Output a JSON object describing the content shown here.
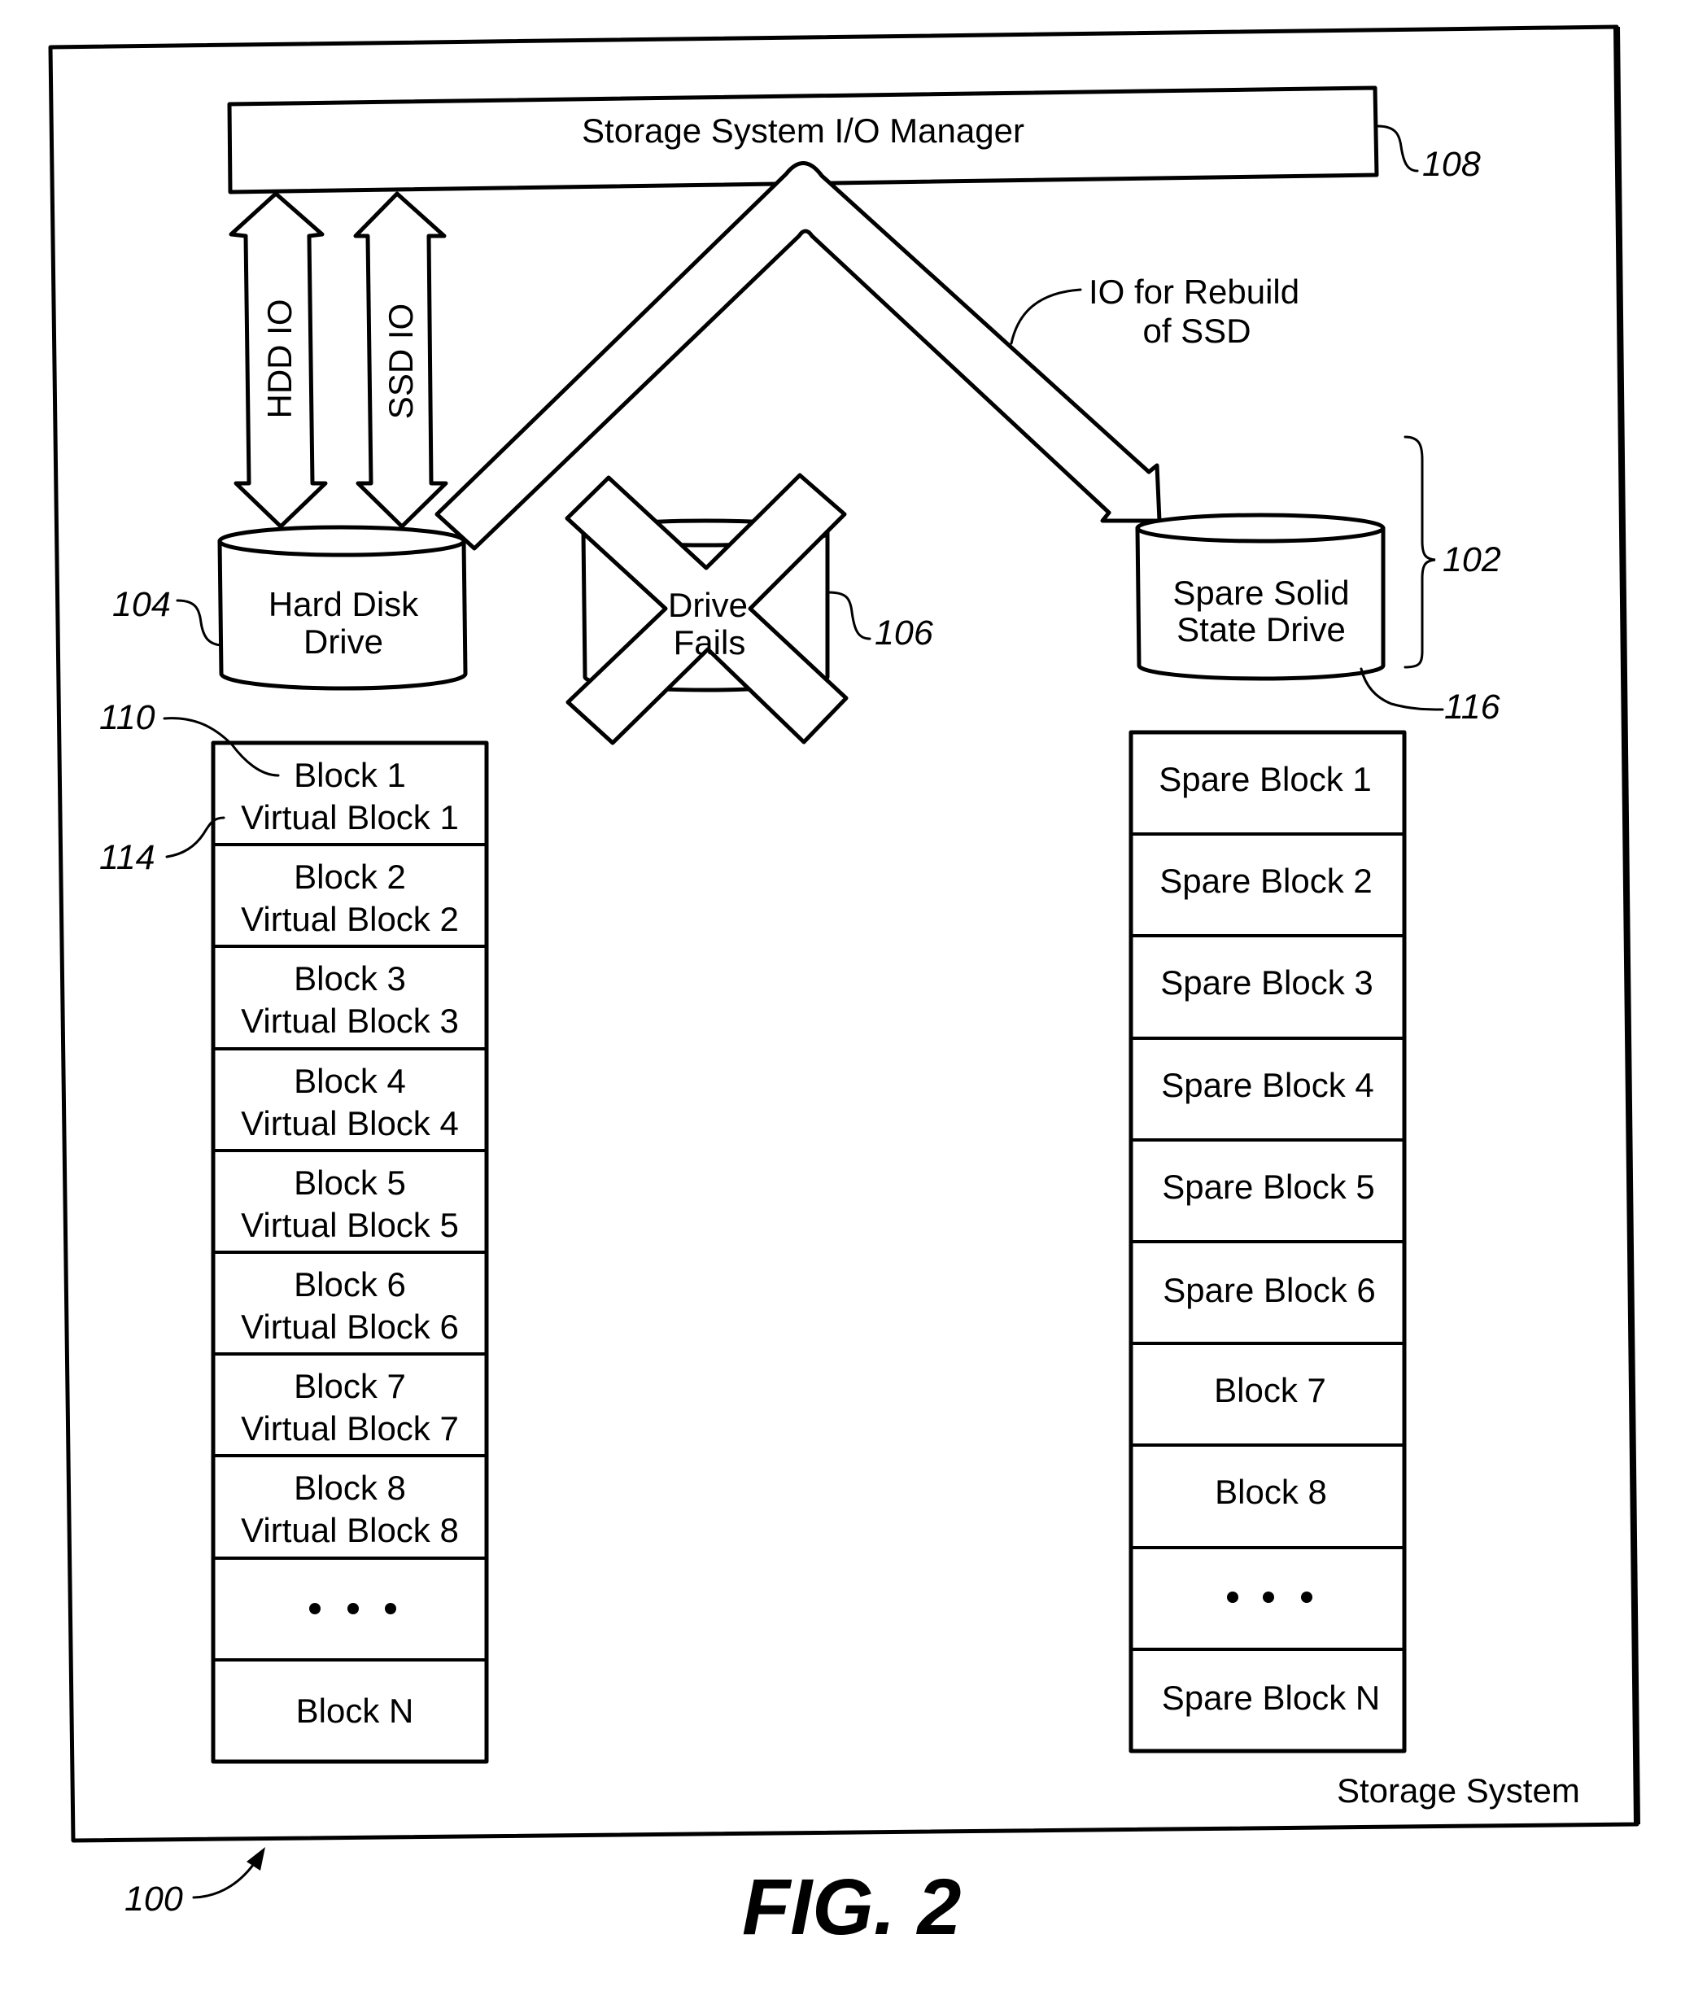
{
  "figure": {
    "label": "FIG. 2",
    "system_label": "Storage System",
    "system_ref": "100"
  },
  "io_manager": {
    "label": "Storage System I/O Manager",
    "ref": "108"
  },
  "io_paths": {
    "hdd_io": "HDD IO",
    "ssd_io": "SSD IO",
    "rebuild_line1": "IO for Rebuild",
    "rebuild_line2": "of SSD"
  },
  "hard_disk_drive": {
    "line1": "Hard Disk",
    "line2": "Drive",
    "ref": "104"
  },
  "failed_drive": {
    "line1": "Drive",
    "line2": "Fails",
    "ref": "106"
  },
  "spare_ssd": {
    "line1": "Spare Solid",
    "line2": "State Drive",
    "ref": "116",
    "group_ref": "102"
  },
  "hdd_blocks": {
    "block_ref": "110",
    "virtual_block_ref": "114",
    "rows": [
      {
        "line1": "Block 1",
        "line2": "Virtual Block 1"
      },
      {
        "line1": "Block 2",
        "line2": "Virtual Block 2"
      },
      {
        "line1": "Block 3",
        "line2": "Virtual Block 3"
      },
      {
        "line1": "Block 4",
        "line2": "Virtual Block 4"
      },
      {
        "line1": "Block 5",
        "line2": "Virtual Block 5"
      },
      {
        "line1": "Block 6",
        "line2": "Virtual Block 6"
      },
      {
        "line1": "Block 7",
        "line2": "Virtual Block 7"
      },
      {
        "line1": "Block 8",
        "line2": "Virtual Block 8"
      },
      {
        "ellipsis": true
      },
      {
        "line1": "Block N"
      }
    ]
  },
  "spare_blocks": {
    "rows": [
      {
        "label": "Spare Block 1"
      },
      {
        "label": "Spare Block 2"
      },
      {
        "label": "Spare Block 3"
      },
      {
        "label": "Spare Block 4"
      },
      {
        "label": "Spare Block 5"
      },
      {
        "label": "Spare Block 6"
      },
      {
        "label": "Block 7"
      },
      {
        "label": "Block 8"
      },
      {
        "ellipsis": true
      },
      {
        "label": "Spare Block N"
      }
    ]
  }
}
